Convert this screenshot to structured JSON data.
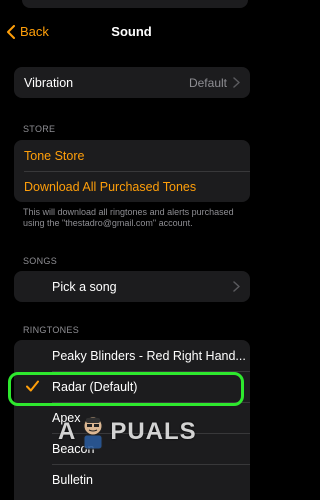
{
  "nav": {
    "back_label": "Back",
    "title": "Sound"
  },
  "vibration": {
    "label": "Vibration",
    "value": "Default"
  },
  "store": {
    "header": "STORE",
    "tone_store": "Tone Store",
    "download_all": "Download All Purchased Tones",
    "note": "This will download all ringtones and alerts purchased using the \"thestadro@gmail.com\" account."
  },
  "songs": {
    "header": "SONGS",
    "pick_a_song": "Pick a song"
  },
  "ringtones": {
    "header": "RINGTONES",
    "items": [
      {
        "label": "Peaky Blinders - Red Right Hand...",
        "selected": false
      },
      {
        "label": "Radar (Default)",
        "selected": true
      },
      {
        "label": "Apex",
        "selected": false
      },
      {
        "label": "Beacon",
        "selected": false
      },
      {
        "label": "Bulletin",
        "selected": false
      }
    ]
  },
  "watermark": {
    "text_left": "A",
    "text_right": "PUALS"
  },
  "colors": {
    "accent": "#ff9f0a",
    "highlight": "#2ee82e",
    "cell_bg": "#1c1c1e",
    "secondary_text": "#8e8e93"
  }
}
